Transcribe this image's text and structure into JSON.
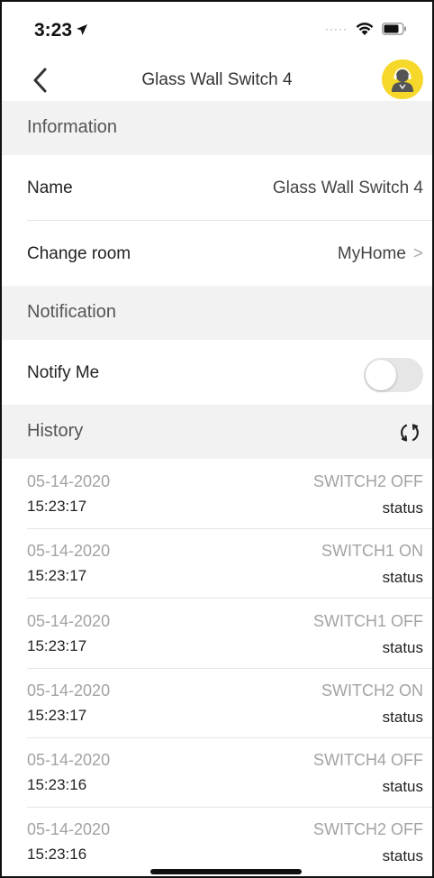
{
  "status_bar": {
    "time": "3:23",
    "location_arrow": "➤"
  },
  "nav": {
    "title": "Glass Wall Switch 4",
    "back_icon": "chevron-left-icon",
    "support_icon": "support-agent-icon"
  },
  "information": {
    "header": "Information",
    "name_label": "Name",
    "name_value": "Glass Wall Switch 4",
    "room_label": "Change room",
    "room_value": "MyHome",
    "chevron": ">"
  },
  "notification": {
    "header": "Notification",
    "notify_label": "Notify Me",
    "notify_enabled": false
  },
  "history": {
    "header": "History",
    "entries": [
      {
        "date": "05-14-2020",
        "time": "15:23:17",
        "event": "SWITCH2 OFF",
        "type": "status"
      },
      {
        "date": "05-14-2020",
        "time": "15:23:17",
        "event": "SWITCH1 ON",
        "type": "status"
      },
      {
        "date": "05-14-2020",
        "time": "15:23:17",
        "event": "SWITCH1 OFF",
        "type": "status"
      },
      {
        "date": "05-14-2020",
        "time": "15:23:17",
        "event": "SWITCH2 ON",
        "type": "status"
      },
      {
        "date": "05-14-2020",
        "time": "15:23:16",
        "event": "SWITCH4 OFF",
        "type": "status"
      },
      {
        "date": "05-14-2020",
        "time": "15:23:16",
        "event": "SWITCH2 OFF",
        "type": "status"
      }
    ]
  },
  "colors": {
    "accent_yellow": "#f6d82b",
    "section_bg": "#f2f2f2",
    "muted_text": "#a3a3a3"
  }
}
